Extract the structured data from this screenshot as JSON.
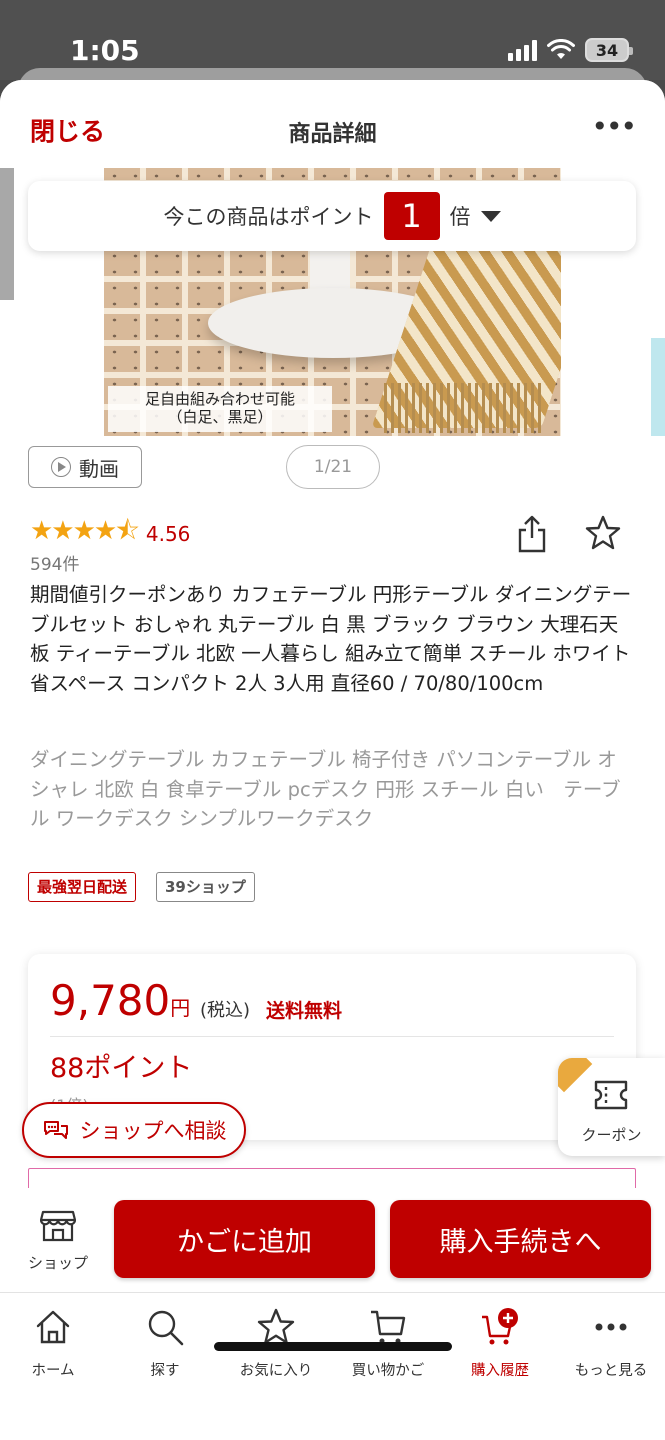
{
  "status_bar": {
    "time": "1:05",
    "battery": "34"
  },
  "header": {
    "close_label": "閉じる",
    "title": "商品詳細",
    "more_label": "•••"
  },
  "points_banner": {
    "text": "今この商品はポイント",
    "multiplier": "1",
    "unit": "倍"
  },
  "image": {
    "caption_line1": "足自由組み合わせ可能",
    "caption_line2": "（白足、黒足）"
  },
  "gallery": {
    "video_label": "動画",
    "page_indicator": "1/21"
  },
  "rating": {
    "stars": "★★★★⯪",
    "value": "4.56",
    "review_count": "594件",
    "score": 4.5
  },
  "product": {
    "title": "期間値引クーポンあり カフェテーブル 円形テーブル ダイニングテーブルセット おしゃれ 丸テーブル 白 黒 ブラック ブラウン 大理石天板 ティーテーブル 北欧 一人暮らし 組み立て簡単 スチール ホワイト 省スペース コンパクト 2人 3人用 直径60 / 70/80/100cm",
    "description": "ダイニングテーブル カフェテーブル 椅子付き パソコンテーブル オシャレ 北欧 白 食卓テーブル pcデスク 円形 スチール 白い　テーブル ワークデスク シンプルワークデスク"
  },
  "tags": {
    "delivery": "最強翌日配送",
    "shop": "39ショップ"
  },
  "price": {
    "amount": "9,780",
    "yen": "円",
    "tax": "(税込)",
    "shipping": "送料無料",
    "points": "88ポイント",
    "points_rate": "(1倍)"
  },
  "consult": {
    "label": "ショップへ相談"
  },
  "coupon": {
    "label": "クーポン"
  },
  "actions": {
    "shop_label": "ショップ",
    "add_cart_label": "かごに追加",
    "checkout_label": "購入手続きへ"
  },
  "tabbar": {
    "items": [
      {
        "label": "ホーム",
        "icon": "home-icon"
      },
      {
        "label": "探す",
        "icon": "search-icon"
      },
      {
        "label": "お気に入り",
        "icon": "star-icon"
      },
      {
        "label": "買い物かご",
        "icon": "cart-icon"
      },
      {
        "label": "購入履歴",
        "icon": "purchase-history-icon"
      },
      {
        "label": "もっと見る",
        "icon": "more-icon"
      }
    ],
    "active_index": 4
  },
  "colors": {
    "brand_red": "#bf0000",
    "star": "#f3a312",
    "coupon_accent": "#e9a93e"
  }
}
